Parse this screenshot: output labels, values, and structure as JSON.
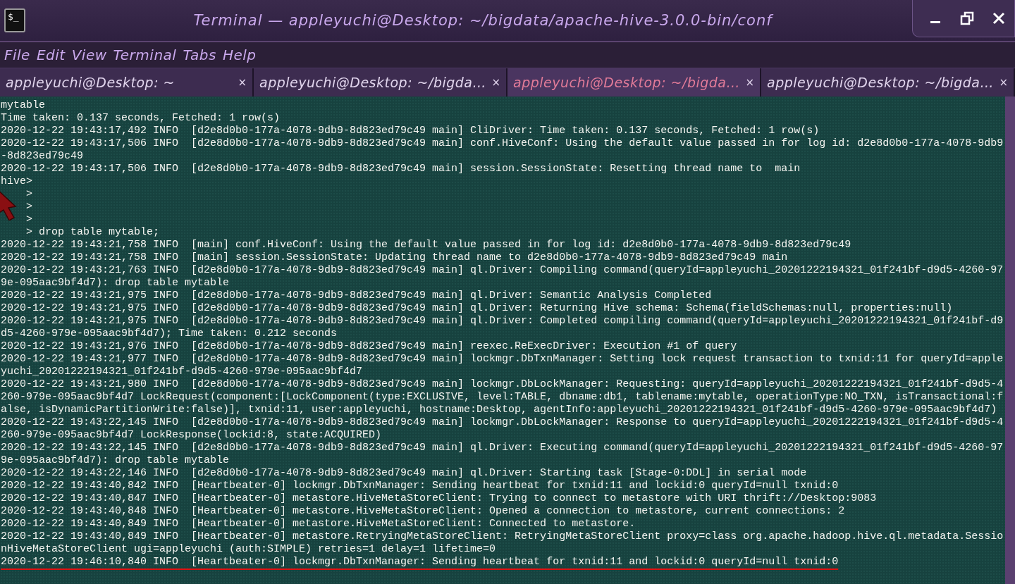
{
  "window": {
    "title": "Terminal — appleyuchi@Desktop: ~/bigdata/apache-hive-3.0.0-bin/conf",
    "icon_text": "$_"
  },
  "menu": [
    "File",
    "Edit",
    "View",
    "Terminal",
    "Tabs",
    "Help"
  ],
  "tabs": [
    {
      "label": "appleyuchi@Desktop: ~",
      "selected": false,
      "close": "×"
    },
    {
      "label": "appleyuchi@Desktop: ~/bigda…",
      "selected": false,
      "close": "×"
    },
    {
      "label": "appleyuchi@Desktop: ~/bigda…",
      "selected": true,
      "close": "×"
    },
    {
      "label": "appleyuchi@Desktop: ~/bigda…",
      "selected": false,
      "close": "×"
    }
  ],
  "terminal": {
    "lines": [
      "mytable",
      "Time taken: 0.137 seconds, Fetched: 1 row(s)",
      "2020-12-22 19:43:17,492 INFO  [d2e8d0b0-177a-4078-9db9-8d823ed79c49 main] CliDriver: Time taken: 0.137 seconds, Fetched: 1 row(s)",
      "2020-12-22 19:43:17,506 INFO  [d2e8d0b0-177a-4078-9db9-8d823ed79c49 main] conf.HiveConf: Using the default value passed in for log id: d2e8d0b0-177a-4078-9db9",
      "-8d823ed79c49",
      "2020-12-22 19:43:17,506 INFO  [d2e8d0b0-177a-4078-9db9-8d823ed79c49 main] session.SessionState: Resetting thread name to  main",
      "hive>",
      "    >",
      "    >",
      "    >",
      "    > drop table mytable;",
      "2020-12-22 19:43:21,758 INFO  [main] conf.HiveConf: Using the default value passed in for log id: d2e8d0b0-177a-4078-9db9-8d823ed79c49",
      "2020-12-22 19:43:21,758 INFO  [main] session.SessionState: Updating thread name to d2e8d0b0-177a-4078-9db9-8d823ed79c49 main",
      "2020-12-22 19:43:21,763 INFO  [d2e8d0b0-177a-4078-9db9-8d823ed79c49 main] ql.Driver: Compiling command(queryId=appleyuchi_20201222194321_01f241bf-d9d5-4260-97",
      "9e-095aac9bf4d7): drop table mytable",
      "2020-12-22 19:43:21,975 INFO  [d2e8d0b0-177a-4078-9db9-8d823ed79c49 main] ql.Driver: Semantic Analysis Completed",
      "2020-12-22 19:43:21,975 INFO  [d2e8d0b0-177a-4078-9db9-8d823ed79c49 main] ql.Driver: Returning Hive schema: Schema(fieldSchemas:null, properties:null)",
      "2020-12-22 19:43:21,975 INFO  [d2e8d0b0-177a-4078-9db9-8d823ed79c49 main] ql.Driver: Completed compiling command(queryId=appleyuchi_20201222194321_01f241bf-d9",
      "d5-4260-979e-095aac9bf4d7); Time taken: 0.212 seconds",
      "2020-12-22 19:43:21,976 INFO  [d2e8d0b0-177a-4078-9db9-8d823ed79c49 main] reexec.ReExecDriver: Execution #1 of query",
      "2020-12-22 19:43:21,977 INFO  [d2e8d0b0-177a-4078-9db9-8d823ed79c49 main] lockmgr.DbTxnManager: Setting lock request transaction to txnid:11 for queryId=apple",
      "yuchi_20201222194321_01f241bf-d9d5-4260-979e-095aac9bf4d7",
      "2020-12-22 19:43:21,980 INFO  [d2e8d0b0-177a-4078-9db9-8d823ed79c49 main] lockmgr.DbLockManager: Requesting: queryId=appleyuchi_20201222194321_01f241bf-d9d5-4",
      "260-979e-095aac9bf4d7 LockRequest(component:[LockComponent(type:EXCLUSIVE, level:TABLE, dbname:db1, tablename:mytable, operationType:NO_TXN, isTransactional:f",
      "alse, isDynamicPartitionWrite:false)], txnid:11, user:appleyuchi, hostname:Desktop, agentInfo:appleyuchi_20201222194321_01f241bf-d9d5-4260-979e-095aac9bf4d7)",
      "2020-12-22 19:43:22,145 INFO  [d2e8d0b0-177a-4078-9db9-8d823ed79c49 main] lockmgr.DbLockManager: Response to queryId=appleyuchi_20201222194321_01f241bf-d9d5-4",
      "260-979e-095aac9bf4d7 LockResponse(lockid:8, state:ACQUIRED)",
      "2020-12-22 19:43:22,145 INFO  [d2e8d0b0-177a-4078-9db9-8d823ed79c49 main] ql.Driver: Executing command(queryId=appleyuchi_20201222194321_01f241bf-d9d5-4260-97",
      "9e-095aac9bf4d7): drop table mytable",
      "2020-12-22 19:43:22,146 INFO  [d2e8d0b0-177a-4078-9db9-8d823ed79c49 main] ql.Driver: Starting task [Stage-0:DDL] in serial mode",
      "2020-12-22 19:43:40,842 INFO  [Heartbeater-0] lockmgr.DbTxnManager: Sending heartbeat for txnid:11 and lockid:0 queryId=null txnid:0",
      "2020-12-22 19:43:40,847 INFO  [Heartbeater-0] metastore.HiveMetaStoreClient: Trying to connect to metastore with URI thrift://Desktop:9083",
      "2020-12-22 19:43:40,848 INFO  [Heartbeater-0] metastore.HiveMetaStoreClient: Opened a connection to metastore, current connections: 2",
      "2020-12-22 19:43:40,849 INFO  [Heartbeater-0] metastore.HiveMetaStoreClient: Connected to metastore.",
      "2020-12-22 19:43:40,849 INFO  [Heartbeater-0] metastore.RetryingMetaStoreClient: RetryingMetaStoreClient proxy=class org.apache.hadoop.hive.ql.metadata.Sessio",
      "nHiveMetaStoreClient ugi=appleyuchi (auth:SIMPLE) retries=1 delay=1 lifetime=0",
      "2020-12-22 19:46:10,840 INFO  [Heartbeater-0] lockmgr.DbTxnManager: Sending heartbeat for txnid:11 and lockid:0 queryId=null txnid:0"
    ],
    "last_line_underlined": true
  }
}
